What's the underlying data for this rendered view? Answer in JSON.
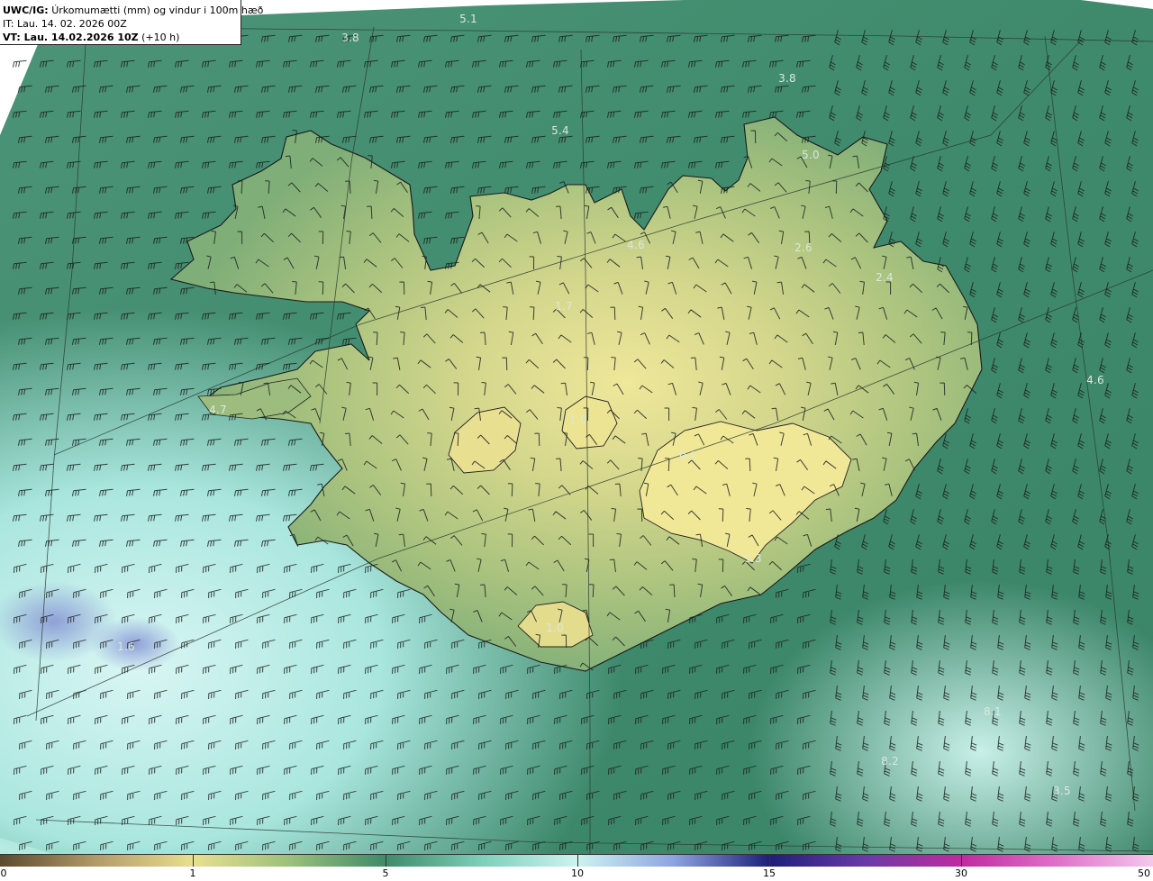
{
  "header": {
    "model_prefix": "UWC/IG:",
    "title": "Úrkomumætti (mm) og vindur i 100m hæð",
    "init_time": "IT: Lau. 14. 02. 2026 00Z",
    "valid_prefix": "VT: Lau. 14.02.2026 10Z",
    "lead_time": "(+10 h)"
  },
  "value_labels": [
    {
      "id": "v1",
      "text": "5.1"
    },
    {
      "id": "v2",
      "text": "3.8"
    },
    {
      "id": "v3",
      "text": "3.8"
    },
    {
      "id": "v4",
      "text": "5.4"
    },
    {
      "id": "v5",
      "text": "5.0"
    },
    {
      "id": "v6",
      "text": "4.6"
    },
    {
      "id": "v7",
      "text": "2.6"
    },
    {
      "id": "v8",
      "text": "2.4"
    },
    {
      "id": "v9",
      "text": "1.7"
    },
    {
      "id": "v10",
      "text": "4.7"
    },
    {
      "id": "v11",
      "text": "4.6"
    },
    {
      "id": "v12",
      "text": "1.0"
    },
    {
      "id": "v13",
      "text": "0.0"
    },
    {
      "id": "v14",
      "text": "1.3"
    },
    {
      "id": "v15",
      "text": "1.0"
    },
    {
      "id": "v16",
      "text": "1.6"
    },
    {
      "id": "v17",
      "text": "8.1"
    },
    {
      "id": "v18",
      "text": "8.2"
    },
    {
      "id": "v19",
      "text": "3.5"
    }
  ],
  "colorbar": {
    "ticks": [
      "0",
      "1",
      "5",
      "10",
      "15",
      "30",
      "50"
    ],
    "colors": {
      "dry": "#5a4a2e",
      "low": "#e8e08e",
      "mid": "#3f8a6a",
      "high": "#cdf3f0",
      "very_high": "#1c1f7a",
      "extreme": "#c02aa0"
    }
  }
}
